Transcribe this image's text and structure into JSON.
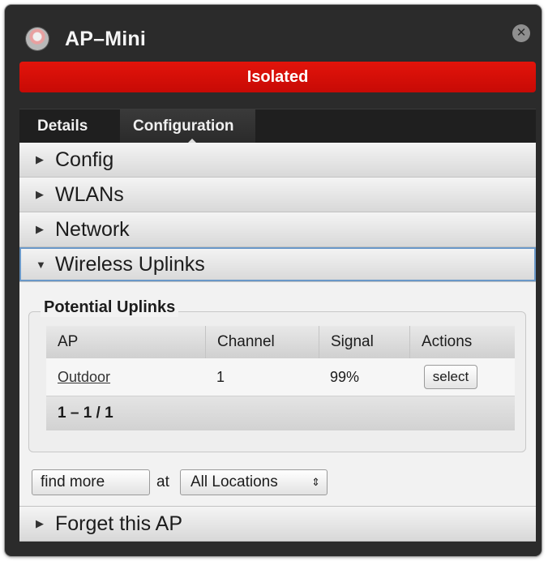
{
  "window": {
    "title": "AP–Mini",
    "status": "Isolated",
    "status_color": "#d90f08"
  },
  "tabs": [
    {
      "label": "Details"
    },
    {
      "label": "Configuration"
    }
  ],
  "sections": {
    "config": "Config",
    "wlans": "WLANs",
    "network": "Network",
    "wireless_uplinks": "Wireless Uplinks",
    "forget": "Forget this AP"
  },
  "uplinks": {
    "legend": "Potential Uplinks",
    "columns": [
      "AP",
      "Channel",
      "Signal",
      "Actions"
    ],
    "rows": [
      {
        "ap": "Outdoor",
        "channel": "1",
        "signal": "99%",
        "action": "select"
      }
    ],
    "pager": "1 – 1 / 1"
  },
  "find": {
    "button": "find more",
    "at": "at",
    "location": "All Locations"
  },
  "icons": {
    "app": "app-indicator-icon",
    "close": "close-icon",
    "collapsed": "triangle-right-icon",
    "expanded": "triangle-down-icon",
    "select_arrows": "updown-arrows-icon"
  }
}
